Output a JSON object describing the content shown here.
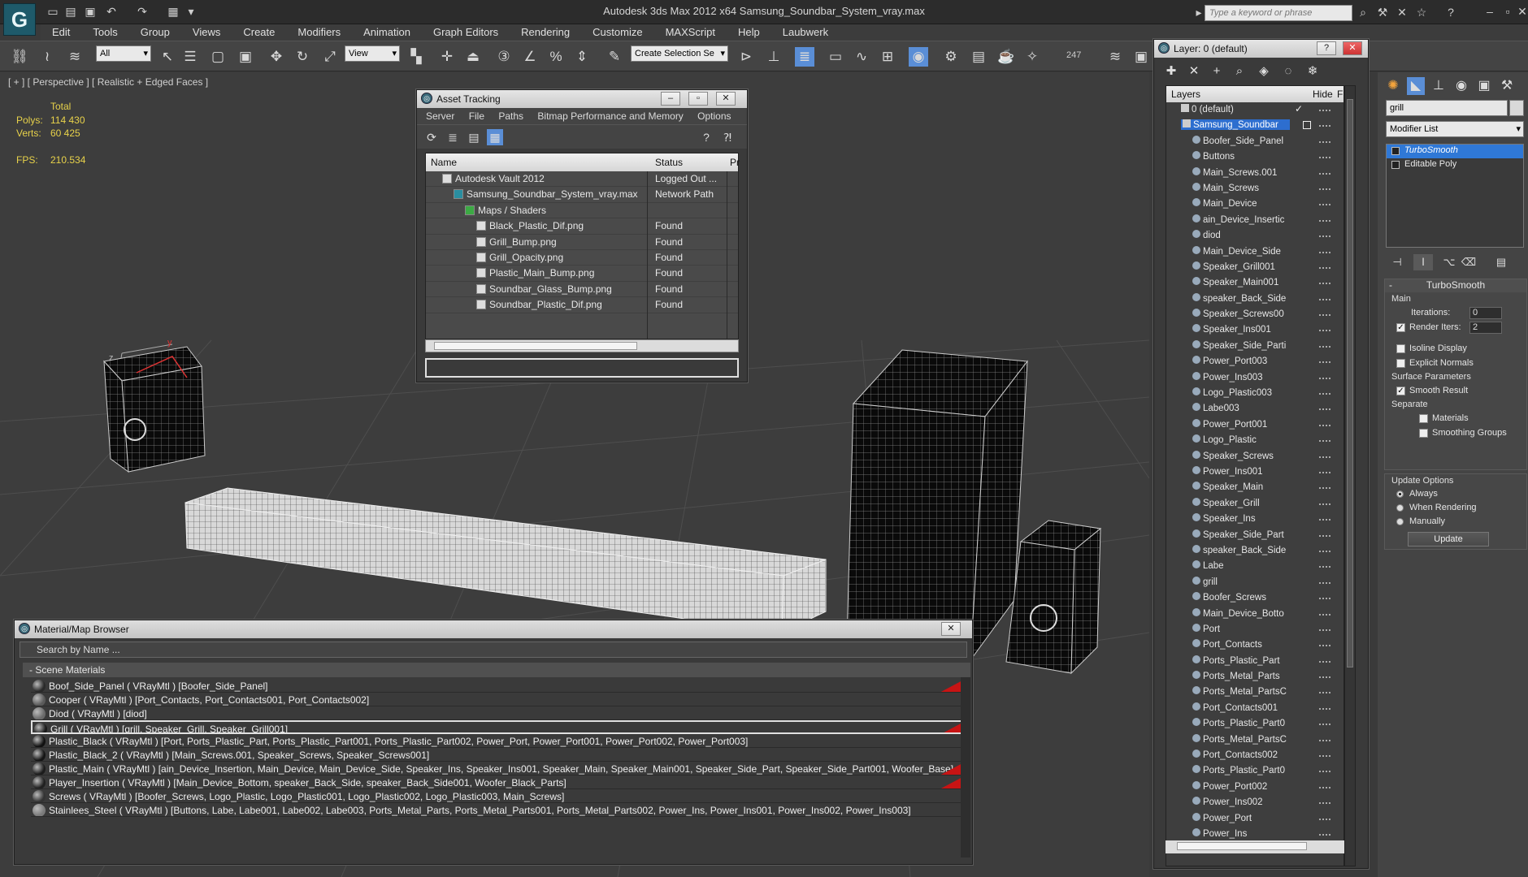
{
  "app": {
    "title": "Autodesk 3ds Max  2012 x64      Samsung_Soundbar_System_vray.max",
    "search_placeholder": "Type a keyword or phrase",
    "logo_glyph": "G"
  },
  "menu": [
    "Edit",
    "Tools",
    "Group",
    "Views",
    "Create",
    "Modifiers",
    "Animation",
    "Graph Editors",
    "Rendering",
    "Customize",
    "MAXScript",
    "Help",
    "Laubwerk"
  ],
  "toolbar": {
    "filter_value": "All",
    "refcoord_value": "View",
    "selection_set_placeholder": "Create Selection Se",
    "counter": "247"
  },
  "viewport": {
    "label": "[ + ] [ Perspective ] [ Realistic + Edged Faces ]",
    "stats": {
      "total_label": "Total",
      "polys_label": "Polys:",
      "polys_value": "114 430",
      "verts_label": "Verts:",
      "verts_value": "60 425",
      "fps_label": "FPS:",
      "fps_value": "210.534"
    },
    "axis_z": "z",
    "axis_y": "y"
  },
  "asset_tracking": {
    "title": "Asset Tracking",
    "menu": [
      "Server",
      "File",
      "Paths",
      "Bitmap Performance and Memory",
      "Options"
    ],
    "columns": [
      "Name",
      "Status",
      "Pr"
    ],
    "rows": [
      {
        "name": "Autodesk Vault 2012",
        "status": "Logged Out ...",
        "indent": 1
      },
      {
        "name": "Samsung_Soundbar_System_vray.max",
        "status": "Network Path",
        "indent": 2
      },
      {
        "name": "Maps / Shaders",
        "status": "",
        "indent": 3
      },
      {
        "name": "Black_Plastic_Dif.png",
        "status": "Found",
        "indent": 4
      },
      {
        "name": "Grill_Bump.png",
        "status": "Found",
        "indent": 4
      },
      {
        "name": "Grill_Opacity.png",
        "status": "Found",
        "indent": 4
      },
      {
        "name": "Plastic_Main_Bump.png",
        "status": "Found",
        "indent": 4
      },
      {
        "name": "Soundbar_Glass_Bump.png",
        "status": "Found",
        "indent": 4
      },
      {
        "name": "Soundbar_Plastic_Dif.png",
        "status": "Found",
        "indent": 4
      }
    ]
  },
  "material_browser": {
    "title": "Material/Map Browser",
    "search_placeholder": "Search by Name ...",
    "group": "- Scene Materials",
    "rows": [
      {
        "text": "Boof_Side_Panel  ( VRayMtl ) [Boofer_Side_Panel]",
        "swatch": "#2a2a2a",
        "flag": true
      },
      {
        "text": "Cooper  ( VRayMtl ) [Port_Contacts, Port_Contacts001, Port_Contacts002]",
        "swatch": "#5a5a5a",
        "flag": false
      },
      {
        "text": "Diod  ( VRayMtl ) [diod]",
        "swatch": "#6a6a6a",
        "flag": false
      },
      {
        "text": "Grill  ( VRayMtl ) [grill, Speaker_Grill, Speaker_Grill001]",
        "swatch": "#1a1a1a",
        "flag": true,
        "selected": true
      },
      {
        "text": "Plastic_Black  ( VRayMtl ) [Port, Ports_Plastic_Part, Ports_Plastic_Part001, Ports_Plastic_Part002, Power_Port, Power_Port001, Power_Port002, Power_Port003]",
        "swatch": "#111111",
        "flag": false
      },
      {
        "text": "Plastic_Black_2  ( VRayMtl ) [Main_Screws.001, Speaker_Screws, Speaker_Screws001]",
        "swatch": "#151515",
        "flag": false
      },
      {
        "text": "Plastic_Main  ( VRayMtl ) [ain_Device_Insertion, Main_Device, Main_Device_Side, Speaker_Ins, Speaker_Ins001, Speaker_Main, Speaker_Main001, Speaker_Side_Part, Speaker_Side_Part001, Woofer_Base]",
        "swatch": "#1c1c1c",
        "flag": true
      },
      {
        "text": "Player_Insertion  ( VRayMtl ) [Main_Device_Bottom, speaker_Back_Side, speaker_Back_Side001, Woofer_Black_Parts]",
        "swatch": "#202020",
        "flag": true
      },
      {
        "text": "Screws  ( VRayMtl ) [Boofer_Screws, Logo_Plastic, Logo_Plastic001, Logo_Plastic002, Logo_Plastic003, Main_Screws]",
        "swatch": "#333333",
        "flag": false
      },
      {
        "text": "Stainlees_Steel  ( VRayMtl ) [Buttons, Labe, Labe001, Labe002, Labe003, Ports_Metal_Parts, Ports_Metal_Parts001, Ports_Metal_Parts002, Power_Ins, Power_Ins001, Power_Ins002, Power_Ins003]",
        "swatch": "#7a7a7a",
        "flag": false
      }
    ]
  },
  "layer_window": {
    "title": "Layer: 0 (default)",
    "col_layers": "Layers",
    "col_hide": "Hide",
    "col_f": "F",
    "layers": [
      {
        "name": "0 (default)",
        "type": "layer",
        "check": true
      },
      {
        "name": "Samsung_Soundbar",
        "type": "layer",
        "selected": true
      },
      {
        "name": "Boofer_Side_Panel",
        "type": "obj"
      },
      {
        "name": "Buttons",
        "type": "obj"
      },
      {
        "name": "Main_Screws.001",
        "type": "obj"
      },
      {
        "name": "Main_Screws",
        "type": "obj"
      },
      {
        "name": "Main_Device",
        "type": "obj"
      },
      {
        "name": "ain_Device_Insertic",
        "type": "obj"
      },
      {
        "name": "diod",
        "type": "obj"
      },
      {
        "name": "Main_Device_Side",
        "type": "obj"
      },
      {
        "name": "Speaker_Grill001",
        "type": "obj"
      },
      {
        "name": "Speaker_Main001",
        "type": "obj"
      },
      {
        "name": "speaker_Back_Side",
        "type": "obj"
      },
      {
        "name": "Speaker_Screws00",
        "type": "obj"
      },
      {
        "name": "Speaker_Ins001",
        "type": "obj"
      },
      {
        "name": "Speaker_Side_Parti",
        "type": "obj"
      },
      {
        "name": "Power_Port003",
        "type": "obj"
      },
      {
        "name": "Power_Ins003",
        "type": "obj"
      },
      {
        "name": "Logo_Plastic003",
        "type": "obj"
      },
      {
        "name": "Labe003",
        "type": "obj"
      },
      {
        "name": "Power_Port001",
        "type": "obj"
      },
      {
        "name": "Logo_Plastic",
        "type": "obj"
      },
      {
        "name": "Speaker_Screws",
        "type": "obj"
      },
      {
        "name": "Power_Ins001",
        "type": "obj"
      },
      {
        "name": "Speaker_Main",
        "type": "obj"
      },
      {
        "name": "Speaker_Grill",
        "type": "obj"
      },
      {
        "name": "Speaker_Ins",
        "type": "obj"
      },
      {
        "name": "Speaker_Side_Part",
        "type": "obj"
      },
      {
        "name": "speaker_Back_Side",
        "type": "obj"
      },
      {
        "name": "Labe",
        "type": "obj"
      },
      {
        "name": "grill",
        "type": "obj"
      },
      {
        "name": "Boofer_Screws",
        "type": "obj"
      },
      {
        "name": "Main_Device_Botto",
        "type": "obj"
      },
      {
        "name": "Port",
        "type": "obj"
      },
      {
        "name": "Port_Contacts",
        "type": "obj"
      },
      {
        "name": "Ports_Plastic_Part",
        "type": "obj"
      },
      {
        "name": "Ports_Metal_Parts",
        "type": "obj"
      },
      {
        "name": "Ports_Metal_PartsC",
        "type": "obj"
      },
      {
        "name": "Port_Contacts001",
        "type": "obj"
      },
      {
        "name": "Ports_Plastic_Part0",
        "type": "obj"
      },
      {
        "name": "Ports_Metal_PartsC",
        "type": "obj"
      },
      {
        "name": "Port_Contacts002",
        "type": "obj"
      },
      {
        "name": "Ports_Plastic_Part0",
        "type": "obj"
      },
      {
        "name": "Power_Port002",
        "type": "obj"
      },
      {
        "name": "Power_Ins002",
        "type": "obj"
      },
      {
        "name": "Power_Port",
        "type": "obj"
      },
      {
        "name": "Power_Ins",
        "type": "obj"
      }
    ]
  },
  "command_panel": {
    "object_name": "grill",
    "modifier_list": "Modifier List",
    "stack": [
      {
        "name": "TurboSmooth",
        "selected": true
      },
      {
        "name": "Editable Poly",
        "selected": false
      }
    ],
    "turbosmooth": {
      "title": "TurboSmooth",
      "main_label": "Main",
      "iterations_label": "Iterations:",
      "iterations_value": "0",
      "render_iters_label": "Render Iters:",
      "render_iters_value": "2",
      "render_iters_checked": true,
      "isoline_label": "Isoline Display",
      "explicit_label": "Explicit Normals",
      "surface_label": "Surface Parameters",
      "smooth_result_label": "Smooth Result",
      "separate_label": "Separate",
      "materials_label": "Materials",
      "smoothing_groups_label": "Smoothing Groups",
      "update_options_label": "Update Options",
      "always_label": "Always",
      "when_rendering_label": "When Rendering",
      "manually_label": "Manually",
      "update_button": "Update"
    }
  },
  "colors": {
    "accent_blue": "#2d6ecf",
    "flag_red": "#c81414",
    "stat_yellow": "#e8d24a"
  }
}
